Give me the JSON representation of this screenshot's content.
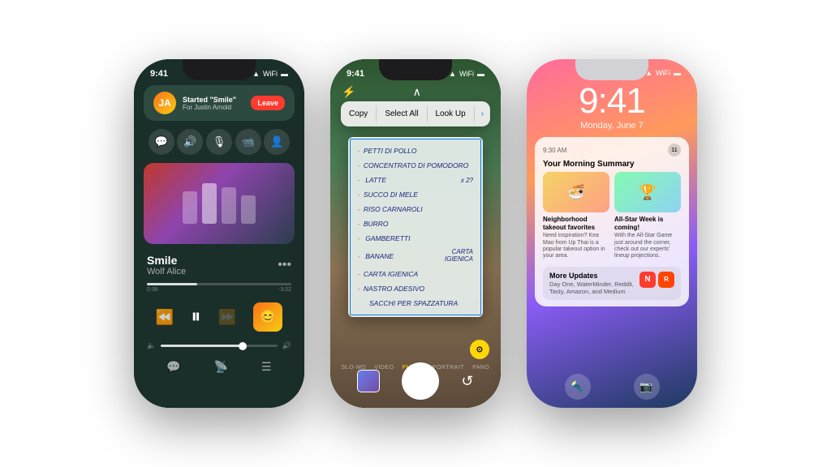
{
  "scene": {
    "background": "#ffffff"
  },
  "phone1": {
    "statusBar": {
      "time": "9:41",
      "icons": [
        "signal",
        "wifi",
        "battery"
      ]
    },
    "shareplay": {
      "title": "Started \"Smile\"",
      "subtitle": "For Justin Arnold",
      "leaveLabel": "Leave"
    },
    "controls": [
      "message",
      "volume",
      "mic",
      "video",
      "person"
    ],
    "song": {
      "title": "Smile",
      "artist": "Wolf Alice",
      "timeElapsed": "0:36",
      "timeRemaining": "-3:02"
    },
    "bottomIcons": [
      "chat",
      "airplay",
      "list"
    ]
  },
  "phone2": {
    "statusBar": {
      "time": "9:41"
    },
    "contextMenu": {
      "items": [
        "Copy",
        "Select All",
        "Look Up"
      ],
      "hasArrow": true
    },
    "note": {
      "lines": [
        "PETTI DI POLLO",
        "CONCENTRATO DI POMODORO",
        "LATTE",
        "SUCCO DI MELE",
        "RISO CARNAROLI",
        "BURRO",
        "GAMBERETTI",
        "BANANE",
        "CARTA IGIENICA",
        "NASTRO ADESIVO",
        "SACCHI PER SPAZZATURA"
      ],
      "annotation": "x 2?"
    },
    "cameraModes": [
      "SLO-MO",
      "VIDEO",
      "PHOTO",
      "PORTRAIT",
      "PANO"
    ],
    "activeMode": "PHOTO"
  },
  "phone3": {
    "statusBar": {
      "time": "9:41"
    },
    "lockTime": "9:41",
    "lockDate": "Monday, June 7",
    "notification": {
      "time": "9:30 AM",
      "title": "Your Morning Summary",
      "badge": "11",
      "articles": [
        {
          "title": "Neighborhood takeout favorites",
          "desc": "Need inspiration? Kea Mao from Up Thai is a popular takeout option in your area."
        },
        {
          "title": "All-Star Week is coming!",
          "desc": "With the All-Star Game just around the corner, check out our experts' lineup projections."
        }
      ],
      "more": {
        "title": "More Updates",
        "desc": "Day One, WaterMinder, Reddit, Tasty, Amazon, and Medium"
      }
    }
  }
}
